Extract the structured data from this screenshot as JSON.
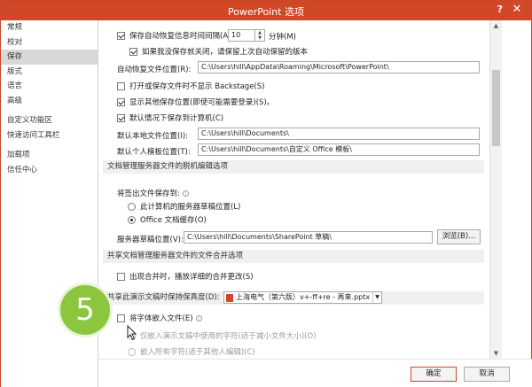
{
  "window": {
    "title": "PowerPoint 选项",
    "help_label": "?",
    "close_label": "✕"
  },
  "sidebar": {
    "items": [
      {
        "label": "常规",
        "active": false
      },
      {
        "label": "校对",
        "active": false
      },
      {
        "label": "保存",
        "active": true
      },
      {
        "label": "版式",
        "active": false
      },
      {
        "label": "语言",
        "active": false
      },
      {
        "label": "高级",
        "active": false
      },
      {
        "label": "自定义功能区",
        "active": false
      },
      {
        "label": "快速访问工具栏",
        "active": false
      },
      {
        "label": "加载项",
        "active": false
      },
      {
        "label": "信任中心",
        "active": false
      }
    ]
  },
  "save": {
    "autorecover_label": "保存自动恢复信息时间间隔(A)",
    "autorecover_minutes": "10",
    "minutes_label": "分钟(M)",
    "keep_last_label": "如果我没保存就关闭，请保留上次自动保留的版本",
    "autorecover_path_label": "自动恢复文件位置(R):",
    "autorecover_path": "C:\\Users\\hill\\AppData\\Roaming\\Microsoft\\PowerPoint\\",
    "no_backstage_label": "打开或保存文件时不显示 Backstage(S)",
    "show_more_label": "显示其他保存位置(即使可能需要登录)(S)。",
    "default_computer_label": "默认情况下保存到计算机(C)",
    "local_path_label": "默认本地文件位置(I):",
    "local_path": "C:\\Users\\hill\\Documents\\",
    "template_path_label": "默认个人模板位置(T):",
    "template_path": "C:\\Users\\hill\\Documents\\自定义 Office 模板\\"
  },
  "offline": {
    "section_title": "文档管理服务器文件的脱机编辑选项",
    "checkout_label": "将签出文件保存到:",
    "option_server": "此计算机的服务器草稿位置(L)",
    "option_cache": "Office 文档缓存(O)",
    "drafts_label": "服务器草稿位置(V):",
    "drafts_path": "C:\\Users\\hill\\Documents\\SharePoint 草稿\\",
    "browse_label": "浏览(B)..."
  },
  "merge": {
    "section_title": "共享文档管理服务器文件的文件合并选项",
    "show_changes_label": "出现合并时，播放详细的合并更改(S)"
  },
  "fidelity": {
    "section_title": "共享此演示文稿时保持保真度(D):",
    "presentation_name": "上海电气（第六版）v+-ff+re - 再来.pptx",
    "embed_fonts_label": "将字体嵌入文件(E)",
    "embed_used_label": "仅嵌入演示文稿中使用的字符(适于减小文件大小)(O)",
    "embed_all_label": "嵌入所有字符(适于其他人编辑)(C)"
  },
  "footer": {
    "ok_label": "确定",
    "cancel_label": "取消"
  },
  "annotation": {
    "step_number": "5"
  },
  "colors": {
    "titlebar": "#d24726",
    "step_badge": "#8cc63f"
  }
}
